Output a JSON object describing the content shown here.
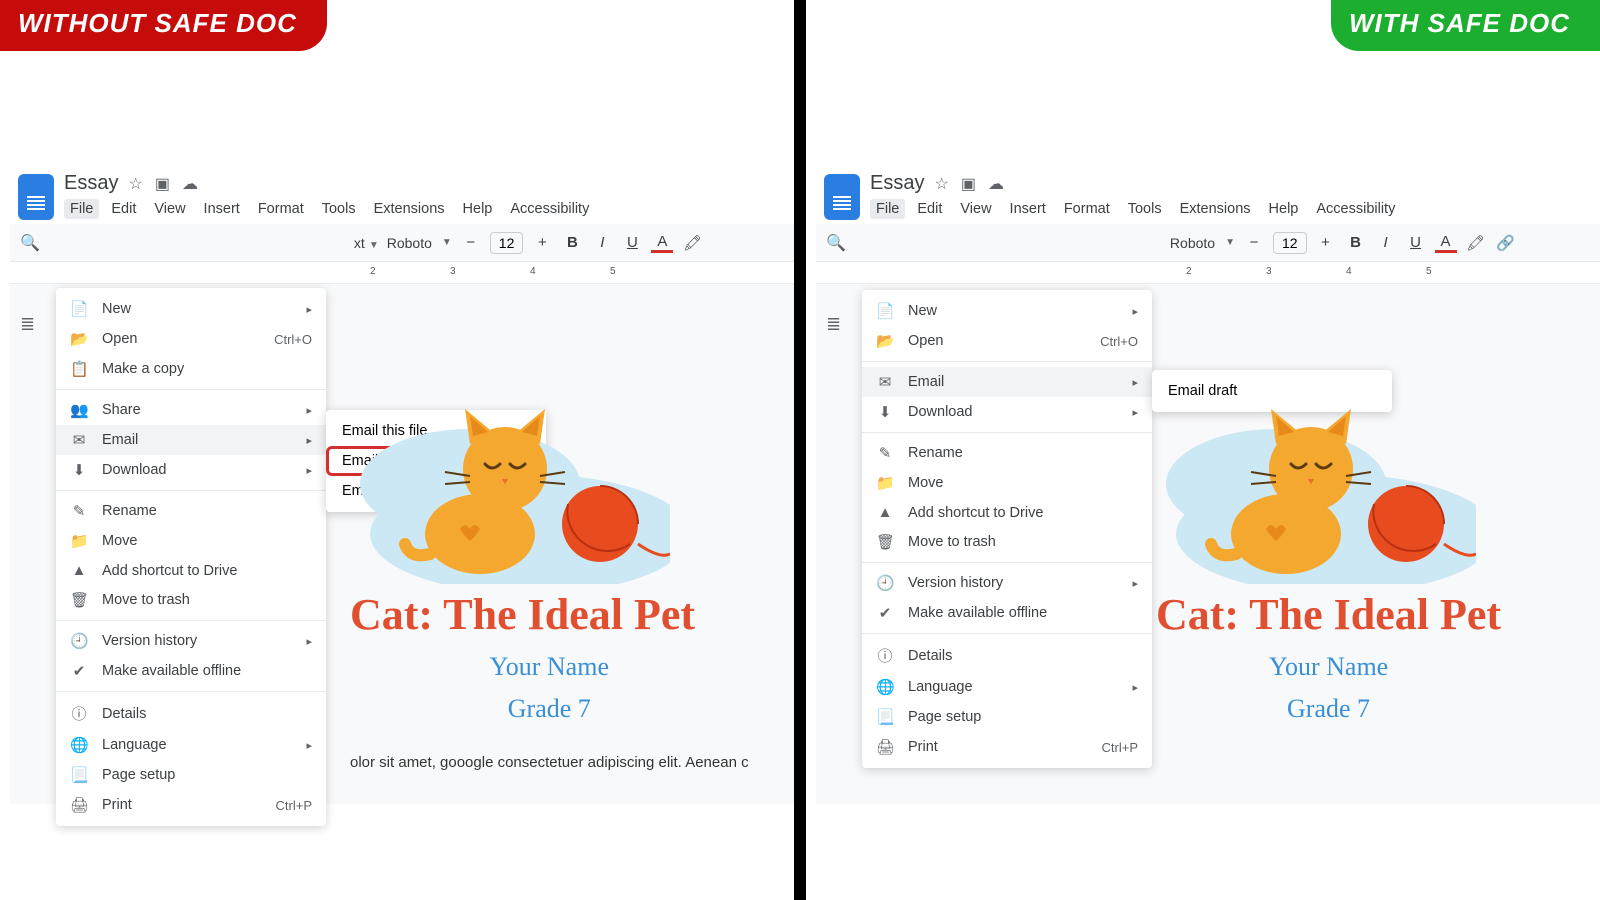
{
  "badges": {
    "without": "WITHOUT SAFE DOC",
    "with": "WITH SAFE DOC"
  },
  "doc": {
    "title": "Essay",
    "heading": "Cat: The Ideal Pet",
    "sub1": "Your Name",
    "sub2": "Grade 7",
    "body_fragment": "olor sit amet, gooogle consectetuer adipiscing elit. Aenean c"
  },
  "menubar": [
    "File",
    "Edit",
    "View",
    "Insert",
    "Format",
    "Tools",
    "Extensions",
    "Help",
    "Accessibility"
  ],
  "toolbar": {
    "font": "Roboto",
    "size": "12",
    "styles_label": "xt"
  },
  "ruler": {
    "t2": "2",
    "t3": "3",
    "t4": "4",
    "t5": "5"
  },
  "file_menu_left": [
    {
      "type": "item",
      "icon": "📄",
      "label": "New",
      "arrow": true
    },
    {
      "type": "item",
      "icon": "📂",
      "label": "Open",
      "shortcut": "Ctrl+O"
    },
    {
      "type": "item",
      "icon": "📋",
      "label": "Make a copy"
    },
    {
      "type": "sep"
    },
    {
      "type": "item",
      "icon": "👥",
      "label": "Share",
      "arrow": true
    },
    {
      "type": "item",
      "icon": "✉",
      "label": "Email",
      "arrow": true,
      "hover": true
    },
    {
      "type": "item",
      "icon": "⬇",
      "label": "Download",
      "arrow": true
    },
    {
      "type": "sep"
    },
    {
      "type": "item",
      "icon": "✎",
      "label": "Rename"
    },
    {
      "type": "item",
      "icon": "📁",
      "label": "Move"
    },
    {
      "type": "item",
      "icon": "▲",
      "label": "Add shortcut to Drive"
    },
    {
      "type": "item",
      "icon": "🗑",
      "label": "Move to trash"
    },
    {
      "type": "sep"
    },
    {
      "type": "item",
      "icon": "🕘",
      "label": "Version history",
      "arrow": true
    },
    {
      "type": "item",
      "icon": "✔",
      "label": "Make available offline"
    },
    {
      "type": "sep"
    },
    {
      "type": "item",
      "icon": "ⓘ",
      "label": "Details"
    },
    {
      "type": "item",
      "icon": "🌐",
      "label": "Language",
      "arrow": true
    },
    {
      "type": "item",
      "icon": "📃",
      "label": "Page setup"
    },
    {
      "type": "item",
      "icon": "🖨",
      "label": "Print",
      "shortcut": "Ctrl+P"
    }
  ],
  "email_submenu_left": [
    {
      "label": "Email this file"
    },
    {
      "label": "Email collaborators",
      "highlighted": true
    },
    {
      "label": "Email draft"
    }
  ],
  "file_menu_right": [
    {
      "type": "item",
      "icon": "📄",
      "label": "New",
      "arrow": true
    },
    {
      "type": "item",
      "icon": "📂",
      "label": "Open",
      "shortcut": "Ctrl+O"
    },
    {
      "type": "sep"
    },
    {
      "type": "item",
      "icon": "✉",
      "label": "Email",
      "arrow": true,
      "hover": true
    },
    {
      "type": "item",
      "icon": "⬇",
      "label": "Download",
      "arrow": true
    },
    {
      "type": "sep"
    },
    {
      "type": "item",
      "icon": "✎",
      "label": "Rename"
    },
    {
      "type": "item",
      "icon": "📁",
      "label": "Move"
    },
    {
      "type": "item",
      "icon": "▲",
      "label": "Add shortcut to Drive"
    },
    {
      "type": "item",
      "icon": "🗑",
      "label": "Move to trash"
    },
    {
      "type": "sep"
    },
    {
      "type": "item",
      "icon": "🕘",
      "label": "Version history",
      "arrow": true
    },
    {
      "type": "item",
      "icon": "✔",
      "label": "Make available offline"
    },
    {
      "type": "sep"
    },
    {
      "type": "item",
      "icon": "ⓘ",
      "label": "Details"
    },
    {
      "type": "item",
      "icon": "🌐",
      "label": "Language",
      "arrow": true
    },
    {
      "type": "item",
      "icon": "📃",
      "label": "Page setup"
    },
    {
      "type": "item",
      "icon": "🖨",
      "label": "Print",
      "shortcut": "Ctrl+P"
    }
  ],
  "email_submenu_right": [
    {
      "label": "Email draft"
    }
  ]
}
